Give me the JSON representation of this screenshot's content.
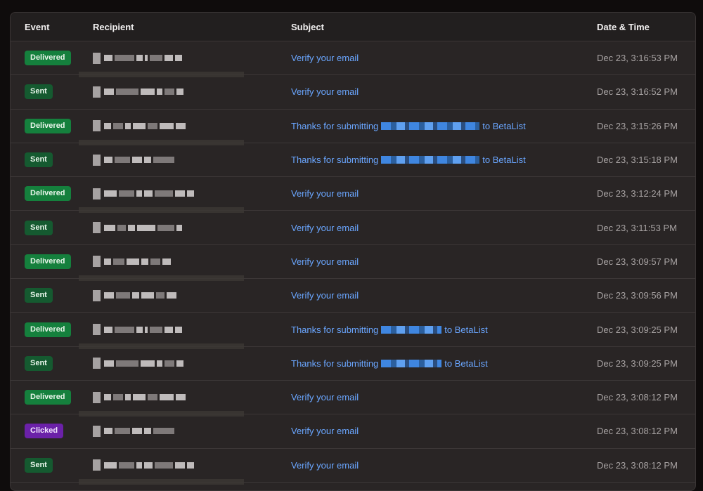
{
  "columns": {
    "event": "Event",
    "recipient": "Recipient",
    "subject": "Subject",
    "date": "Date & Time"
  },
  "rows": [
    {
      "event": "Delivered",
      "subject": "Verify your email",
      "date": "Dec 23, 3:16:53 PM"
    },
    {
      "event": "Sent",
      "subject": "Verify your email",
      "date": "Dec 23, 3:16:52 PM"
    },
    {
      "event": "Delivered",
      "subject_prefix": "Thanks for submitting",
      "subject_suffix": "to BetaList",
      "date": "Dec 23, 3:15:26 PM"
    },
    {
      "event": "Sent",
      "subject_prefix": "Thanks for submitting",
      "subject_suffix": "to BetaList",
      "date": "Dec 23, 3:15:18 PM"
    },
    {
      "event": "Delivered",
      "subject": "Verify your email",
      "date": "Dec 23, 3:12:24 PM"
    },
    {
      "event": "Sent",
      "subject": "Verify your email",
      "date": "Dec 23, 3:11:53 PM"
    },
    {
      "event": "Delivered",
      "subject": "Verify your email",
      "date": "Dec 23, 3:09:57 PM"
    },
    {
      "event": "Sent",
      "subject": "Verify your email",
      "date": "Dec 23, 3:09:56 PM"
    },
    {
      "event": "Delivered",
      "subject_prefix": "Thanks for submitting",
      "subject_suffix": "to BetaList",
      "date": "Dec 23, 3:09:25 PM"
    },
    {
      "event": "Sent",
      "subject_prefix": "Thanks for submitting",
      "subject_suffix": "to BetaList",
      "date": "Dec 23, 3:09:25 PM"
    },
    {
      "event": "Delivered",
      "subject": "Verify your email",
      "date": "Dec 23, 3:08:12 PM"
    },
    {
      "event": "Clicked",
      "subject": "Verify your email",
      "date": "Dec 23, 3:08:12 PM"
    },
    {
      "event": "Sent",
      "subject": "Verify your email",
      "date": "Dec 23, 3:08:12 PM"
    }
  ],
  "colors": {
    "delivered": "#15803d",
    "sent": "#155a30",
    "clicked": "#6b21a8",
    "link": "#6aa6ff"
  }
}
